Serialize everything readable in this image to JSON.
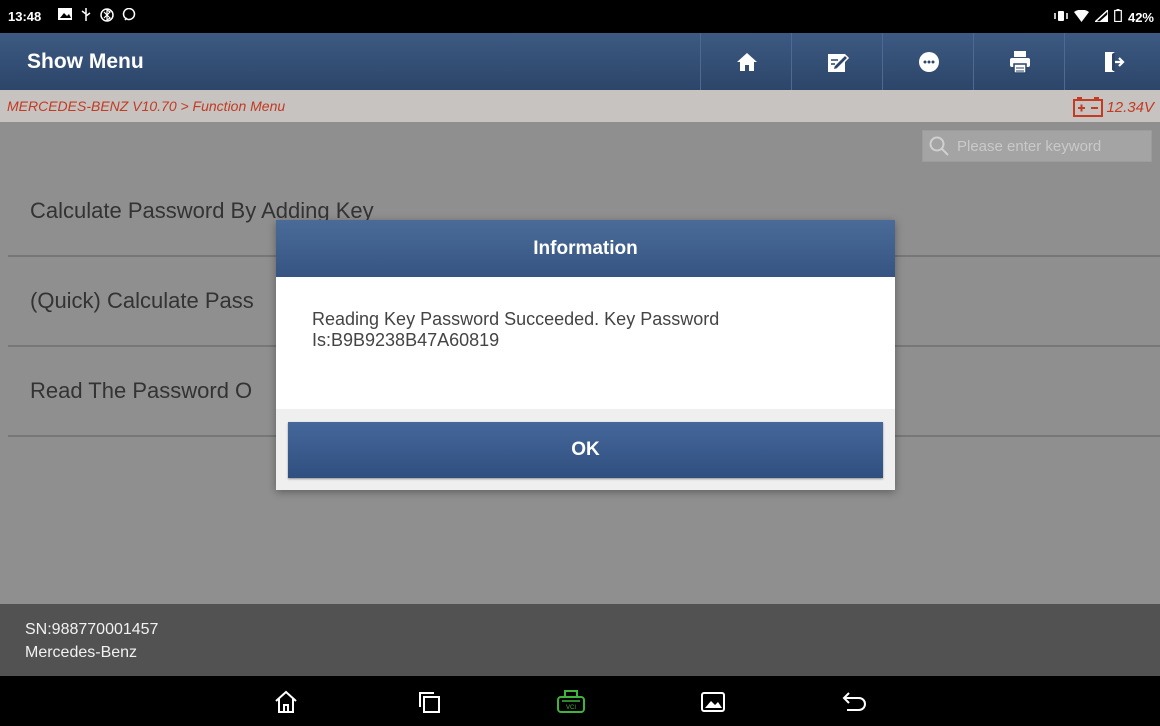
{
  "status_bar": {
    "time": "13:48",
    "battery": "42%",
    "left_icons": [
      "image-icon",
      "usb-icon",
      "bluetooth-icon",
      "chat-icon"
    ],
    "right_icons": [
      "vibrate-icon",
      "wifi-icon",
      "signal-icon",
      "battery-icon"
    ]
  },
  "header": {
    "title": "Show Menu",
    "buttons": [
      "home-icon",
      "edit-icon",
      "message-icon",
      "print-icon",
      "exit-icon"
    ]
  },
  "breadcrumb": {
    "path": "MERCEDES-BENZ V10.70 > Function Menu",
    "voltage": "12.34V"
  },
  "search": {
    "placeholder": "Please enter keyword"
  },
  "menu": {
    "items": [
      {
        "label": "Calculate Password By Adding Key"
      },
      {
        "label": "(Quick) Calculate Pass"
      },
      {
        "label": "Read The Password O"
      }
    ]
  },
  "footer": {
    "sn": "SN:988770001457",
    "make": "Mercedes-Benz"
  },
  "dialog": {
    "title": "Information",
    "message_line1": "Reading Key Password Succeeded. Key Password",
    "message_line2": "Is:B9B9238B47A60819",
    "ok_label": "OK"
  },
  "navbar": {
    "buttons": [
      "home-icon",
      "recents-icon",
      "vci-icon",
      "screenshot-icon",
      "back-icon"
    ],
    "accent": "#3fb33a"
  }
}
